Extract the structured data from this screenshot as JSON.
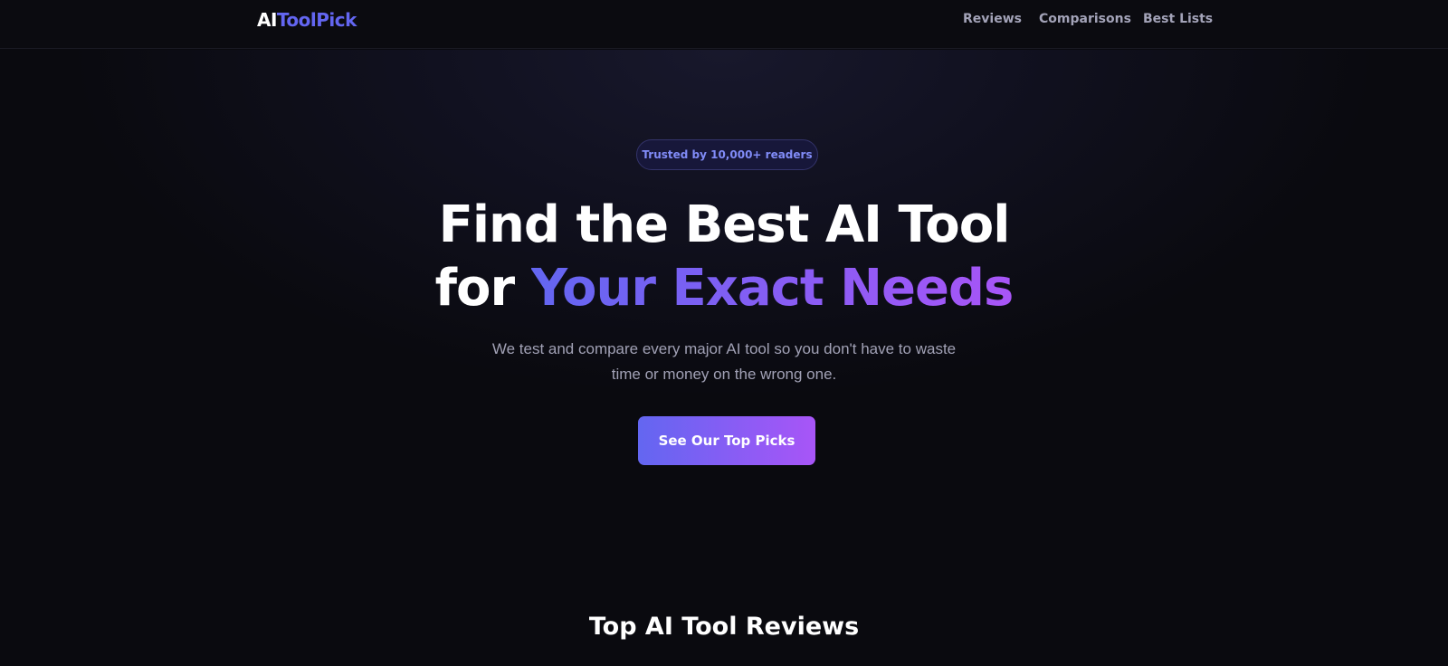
{
  "nav": {
    "logo_ai": "AI",
    "logo_rest": "ToolPick",
    "links": [
      "Reviews",
      "Comparisons",
      "Best Lists"
    ]
  },
  "hero": {
    "badge": "Trusted by 10,000+ readers",
    "headline_line1": "Find the Best AI Tool",
    "headline_line2_plain": "for",
    "headline_line2_gradient": "Your Exact Needs",
    "subtitle": "We test and compare every major AI tool so you don't have to waste time or money on the wrong one.",
    "cta_label": "See Our Top Picks"
  },
  "section": {
    "title": "Top AI Tool Reviews"
  },
  "colors": {
    "background": "#0a0a0f",
    "accent_start": "#6366f1",
    "accent_end": "#a855f7",
    "muted_text": "#a1a1b5"
  }
}
